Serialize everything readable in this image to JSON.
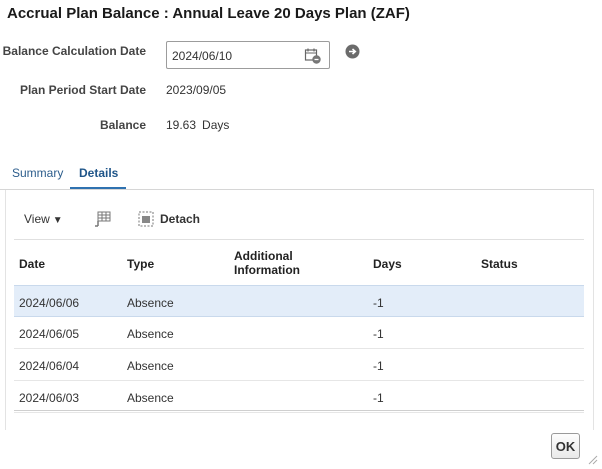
{
  "dialog": {
    "title": "Accrual Plan Balance : Annual Leave 20 Days Plan (ZAF)",
    "ok_label": "OK"
  },
  "form": {
    "balance_calc_date_label": "Balance Calculation Date",
    "balance_calc_date_value": "2024/06/10",
    "plan_period_start_label": "Plan Period Start Date",
    "plan_period_start_value": "2023/09/05",
    "balance_label": "Balance",
    "balance_value": "19.63",
    "balance_unit": "Days"
  },
  "tabs": [
    {
      "label": "Summary",
      "active": false
    },
    {
      "label": "Details",
      "active": true
    }
  ],
  "toolbar": {
    "view_label": "View",
    "detach_label": "Detach"
  },
  "table": {
    "headers": {
      "date": "Date",
      "type": "Type",
      "additional_line1": "Additional",
      "additional_line2": "Information",
      "days": "Days",
      "status": "Status"
    },
    "rows": [
      {
        "date": "2024/06/06",
        "type": "Absence",
        "additional": "",
        "days": "-1",
        "status": "",
        "selected": true
      },
      {
        "date": "2024/06/05",
        "type": "Absence",
        "additional": "",
        "days": "-1",
        "status": ""
      },
      {
        "date": "2024/06/04",
        "type": "Absence",
        "additional": "",
        "days": "-1",
        "status": ""
      },
      {
        "date": "2024/06/03",
        "type": "Absence",
        "additional": "",
        "days": "-1",
        "status": ""
      }
    ]
  },
  "icons": {
    "calendar": "calendar-icon",
    "go": "go-arrow-icon",
    "freeze": "freeze-columns-icon",
    "detach": "detach-icon",
    "view_caret": "caret-down-icon",
    "resize": "resize-grip-icon"
  },
  "colors": {
    "accent_tab": "#2f72b0",
    "selected_row": "#e3edf9",
    "link_text": "#2c5d8c"
  }
}
